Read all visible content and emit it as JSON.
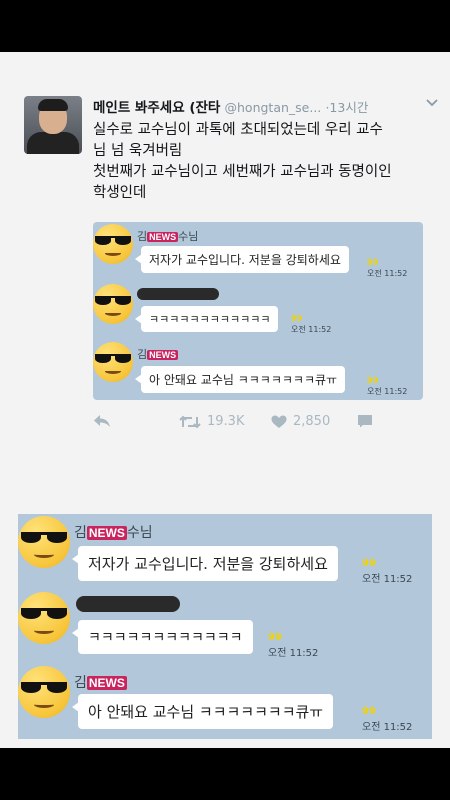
{
  "tweet": {
    "display_name": "메인트 봐주세요 (잔타",
    "handle": "@hongtan_se...",
    "separator": "·",
    "time": "13시간",
    "text_line1": "실수로 교수님이 과톡에 초대되었는데 우리 교수\n님 넘 욱겨버림",
    "text_line2": "첫번째가 교수님이고 세번째가 교수님과 동명이인\n학생인데",
    "retweets": "19.3K",
    "likes": "2,850"
  },
  "chat": {
    "news_badge": "NEWS",
    "messages": [
      {
        "sender_prefix": "김",
        "sender_suffix": "수님",
        "text": "저자가 교수입니다. 저분을 강퇴하세요",
        "unread": "99",
        "time": "오전 11:52"
      },
      {
        "text": "ㅋㅋㅋㅋㅋㅋㅋㅋㅋㅋㅋㅋ",
        "unread": "99",
        "time": "오전 11:52"
      },
      {
        "sender_prefix": "김",
        "text": "아 안돼요 교수님 ㅋㅋㅋㅋㅋㅋㅋ큐ㅠ",
        "unread": "99",
        "time": "오전 11:52"
      }
    ]
  },
  "colors": {
    "chat_background": "#b2c7d9",
    "news_badge": "#c8245e",
    "unread_count": "#f2d300",
    "muted_text": "#8899a6"
  },
  "icons": [
    "reply-icon",
    "retweet-icon",
    "heart-icon",
    "message-icon",
    "chevron-down-icon",
    "sunglasses-emoji-avatar"
  ]
}
